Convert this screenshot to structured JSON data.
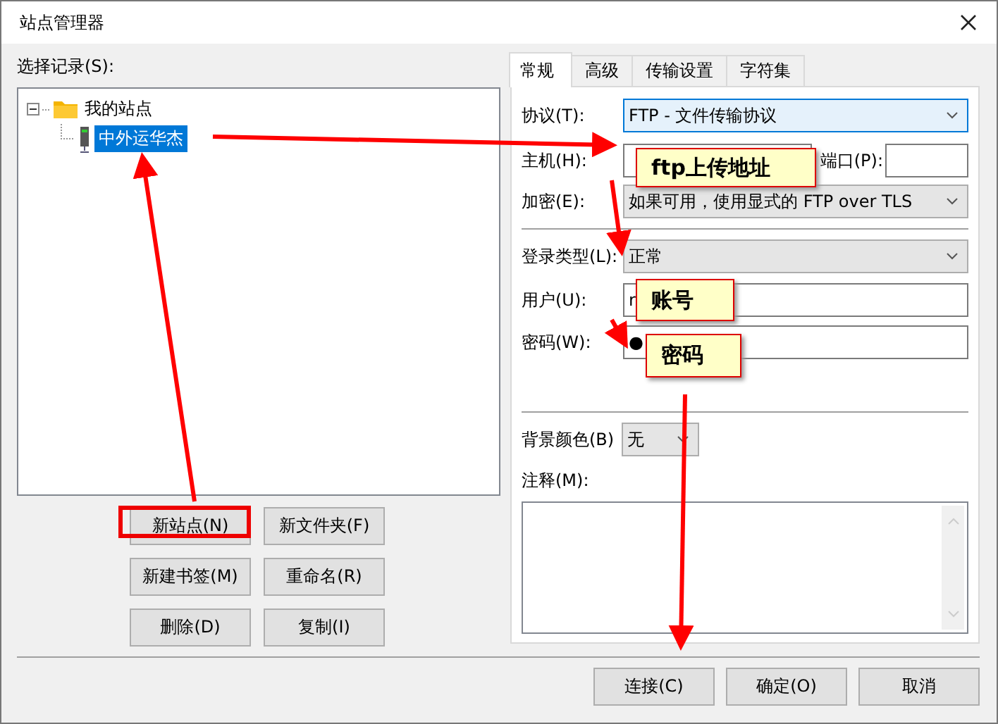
{
  "window": {
    "title": "站点管理器"
  },
  "site_list": {
    "label": "选择记录(S):",
    "tree": [
      {
        "label": "我的站点",
        "expanded": true,
        "children": [
          {
            "label": "中外运华杰",
            "selected": true
          }
        ]
      }
    ]
  },
  "site_buttons": [
    {
      "label": "新站点(N)",
      "highlighted": true
    },
    {
      "label": "新文件夹(F)",
      "highlighted": false
    },
    {
      "label": "新建书签(M)",
      "highlighted": false
    },
    {
      "label": "重命名(R)",
      "highlighted": false
    },
    {
      "label": "删除(D)",
      "highlighted": false
    },
    {
      "label": "复制(I)",
      "highlighted": false
    }
  ],
  "tabs": [
    {
      "label": "常规",
      "selected": true
    },
    {
      "label": "高级",
      "selected": false
    },
    {
      "label": "传输设置",
      "selected": false
    },
    {
      "label": "字符集",
      "selected": false
    }
  ],
  "form": {
    "protocol": {
      "label": "协议(T):",
      "value": "FTP - 文件传输协议"
    },
    "host": {
      "label": "主机(H):"
    },
    "port": {
      "label": "端口(P):"
    },
    "encryption": {
      "label": "加密(E):",
      "value": "如果可用，使用显式的 FTP over TLS"
    },
    "logon_type": {
      "label": "登录类型(L):",
      "value": "正常"
    },
    "user": {
      "label": "用户(U):",
      "value": "r"
    },
    "password": {
      "label": "密码(W):",
      "value": "●"
    },
    "background_color": {
      "label": "背景颜色(B)",
      "value": "无"
    },
    "comments": {
      "label": "注释(M):"
    }
  },
  "dialog_buttons": [
    "连接(C)",
    "确定(O)",
    "取消"
  ],
  "annotations": {
    "callouts": [
      "ftp上传地址",
      "账号",
      "密码"
    ]
  }
}
